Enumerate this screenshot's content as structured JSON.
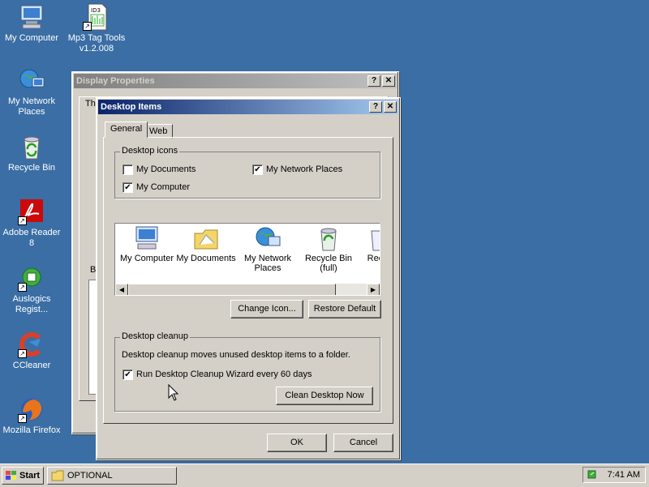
{
  "desktop": {
    "icons": [
      {
        "label": "My Computer"
      },
      {
        "label": "Mp3 Tag Tools v1.2.008"
      },
      {
        "label": "My Network Places"
      },
      {
        "label": "Recycle Bin"
      },
      {
        "label": "Adobe Reader 8"
      },
      {
        "label": "Auslogics Regist..."
      },
      {
        "label": "CCleaner"
      },
      {
        "label": "Mozilla Firefox"
      }
    ]
  },
  "display_properties": {
    "title": "Display Properties",
    "tab_fragment": "Th",
    "label_fragment": "B"
  },
  "dialog": {
    "title": "Desktop Items",
    "tabs": [
      {
        "label": "General"
      },
      {
        "label": "Web"
      }
    ],
    "desktop_icons": {
      "legend": "Desktop icons",
      "my_documents": "My Documents",
      "my_network_places": "My Network Places",
      "my_computer": "My Computer",
      "checks": {
        "my_documents": "",
        "my_network_places": "✔",
        "my_computer": "✔"
      }
    },
    "iconlist": [
      {
        "label": "My Computer"
      },
      {
        "label": "My Documents"
      },
      {
        "label": "My Network Places"
      },
      {
        "label": "Recycle Bin (full)"
      },
      {
        "label": "Rec..."
      }
    ],
    "change_icon": "Change Icon...",
    "restore_default": "Restore Default",
    "cleanup": {
      "legend": "Desktop cleanup",
      "description": "Desktop cleanup moves unused desktop items to a folder.",
      "run_wizard": "Run Desktop Cleanup Wizard every 60 days",
      "run_wizard_check": "✔",
      "clean_now": "Clean Desktop Now"
    },
    "ok": "OK",
    "cancel": "Cancel",
    "help_glyph": "?",
    "close_glyph": "✕"
  },
  "taskbar": {
    "start": "Start",
    "task": "OPTIONAL",
    "clock": "7:41 AM"
  }
}
